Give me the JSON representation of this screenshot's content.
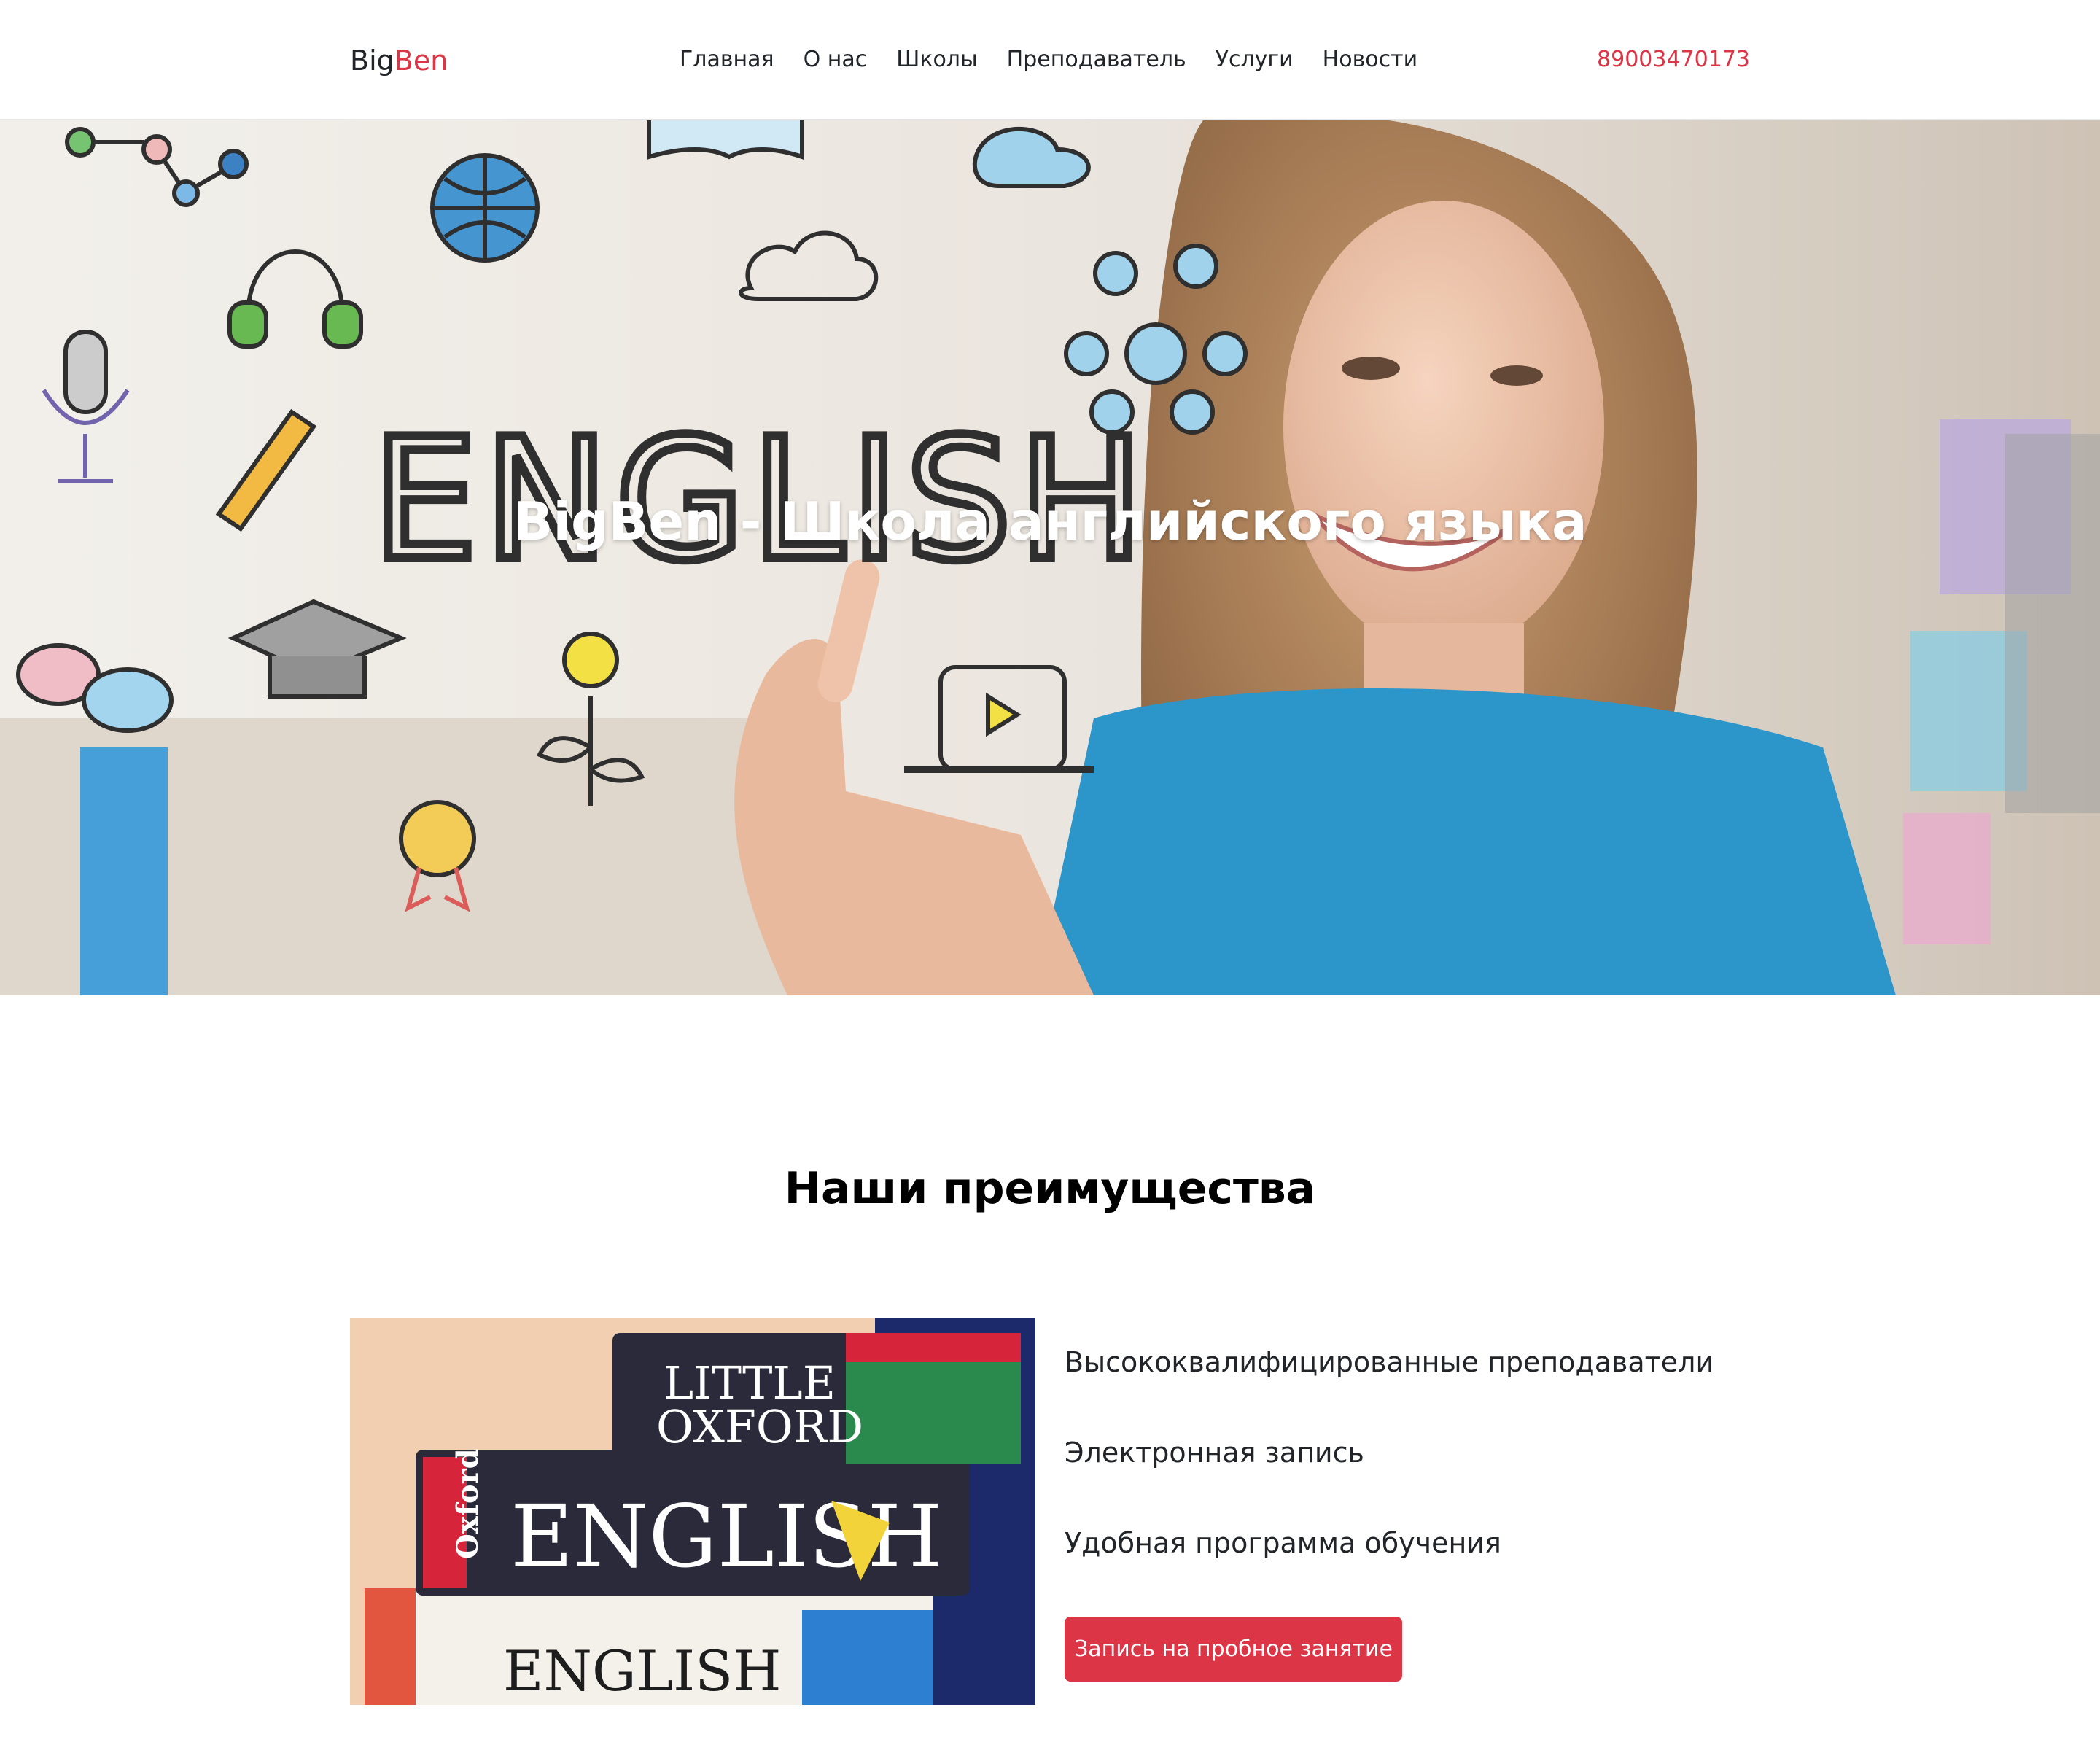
{
  "navbar": {
    "brand_part1": "Big",
    "brand_part2": "Ben",
    "links": [
      "Главная",
      "О нас",
      "Школы",
      "Преподаватель",
      "Услуги",
      "Новости"
    ],
    "phone": "89003470173"
  },
  "hero": {
    "title": "BigBen - Школа английского языка",
    "image_text": "ENGLISH"
  },
  "advantages": {
    "title": "Наши преимущества",
    "items": [
      "Высококвалифицированные преподаватели",
      "Электронная запись",
      "Удобная программа обучения"
    ],
    "cta_label": "Запись на пробное занятие",
    "image_text": {
      "book1_line1": "LITTLE",
      "book1_line2": "OXFORD",
      "book2_brand": "Oxford",
      "book2_title": "ENGLISH",
      "book3_title": "ENGLISH"
    }
  },
  "colors": {
    "accent": "#dc3545",
    "text": "#212529",
    "hero_title": "#ffffff"
  }
}
